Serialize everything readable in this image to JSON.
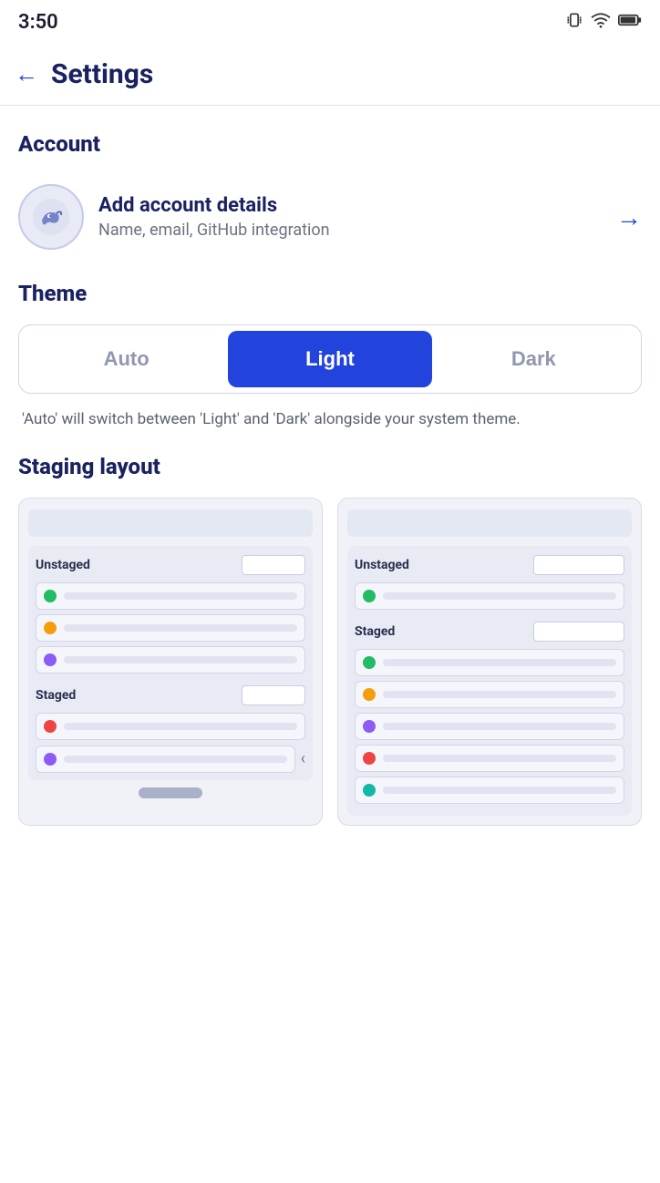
{
  "statusBar": {
    "time": "3:50",
    "icons": [
      "vibrate",
      "wifi",
      "battery"
    ]
  },
  "header": {
    "backLabel": "←",
    "title": "Settings"
  },
  "account": {
    "sectionTitle": "Account",
    "rowTitle": "Add account details",
    "rowSubtitle": "Name, email, GitHub integration",
    "arrowLabel": "→"
  },
  "theme": {
    "sectionTitle": "Theme",
    "options": [
      {
        "label": "Auto",
        "active": false
      },
      {
        "label": "Light",
        "active": true
      },
      {
        "label": "Dark",
        "active": false
      }
    ],
    "hint": "'Auto' will switch between 'Light' and 'Dark' alongside your system theme."
  },
  "stagingLayout": {
    "sectionTitle": "Staging layout",
    "leftCard": {
      "unstaged": "Unstaged",
      "items1": [
        {
          "color": "green"
        },
        {
          "color": "orange"
        },
        {
          "color": "purple"
        }
      ],
      "staged": "Staged",
      "items2": [
        {
          "color": "red"
        },
        {
          "color": "purple"
        }
      ]
    },
    "rightCard": {
      "unstaged": "Unstaged",
      "items1": [
        {
          "color": "green"
        }
      ],
      "staged": "Staged",
      "items2": [
        {
          "color": "green"
        },
        {
          "color": "orange"
        },
        {
          "color": "purple"
        },
        {
          "color": "red"
        },
        {
          "color": "teal"
        }
      ]
    }
  }
}
